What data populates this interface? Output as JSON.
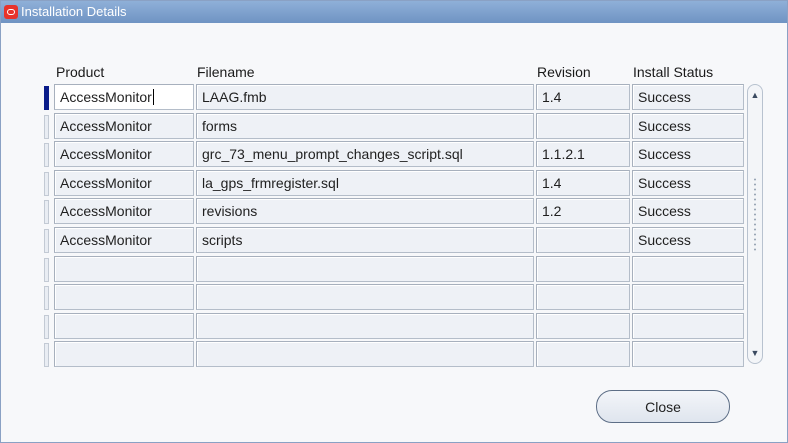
{
  "window": {
    "title": "Installation Details",
    "accent_color": "#6f93c3",
    "icon": "oracle-logo-icon"
  },
  "table": {
    "columns": [
      "Product",
      "Filename",
      "Revision",
      "Install Status"
    ],
    "rows": [
      {
        "product": "AccessMonitor",
        "filename": "LAAG.fmb",
        "revision": "1.4",
        "status": "Success"
      },
      {
        "product": "AccessMonitor",
        "filename": "forms",
        "revision": "",
        "status": "Success"
      },
      {
        "product": "AccessMonitor",
        "filename": "grc_73_menu_prompt_changes_script.sql",
        "revision": "1.1.2.1",
        "status": "Success"
      },
      {
        "product": "AccessMonitor",
        "filename": "la_gps_frmregister.sql",
        "revision": "1.4",
        "status": "Success"
      },
      {
        "product": "AccessMonitor",
        "filename": "revisions",
        "revision": "1.2",
        "status": "Success"
      },
      {
        "product": "AccessMonitor",
        "filename": "scripts",
        "revision": "",
        "status": "Success"
      },
      {
        "product": "",
        "filename": "",
        "revision": "",
        "status": ""
      },
      {
        "product": "",
        "filename": "",
        "revision": "",
        "status": ""
      },
      {
        "product": "",
        "filename": "",
        "revision": "",
        "status": ""
      },
      {
        "product": "",
        "filename": "",
        "revision": "",
        "status": ""
      }
    ],
    "current_row": 0
  },
  "scrollbar": {
    "up_icon": "scroll-up-arrow-icon",
    "down_icon": "scroll-down-arrow-icon"
  },
  "buttons": {
    "close_label": "Close"
  }
}
